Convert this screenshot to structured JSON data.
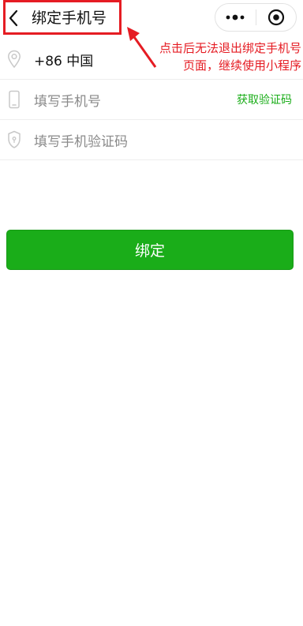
{
  "navbar": {
    "title": "绑定手机号",
    "back_icon": "chevron-left-icon",
    "more_icon": "more-dots-icon",
    "close_icon": "target-circle-icon"
  },
  "annotation": {
    "text": "点击后无法退出绑定手机号页面，继续使用小程序",
    "color": "#e51c23"
  },
  "form": {
    "region": {
      "icon": "location-pin-icon",
      "value": "+86 中国"
    },
    "phone": {
      "icon": "mobile-phone-icon",
      "placeholder": "填写手机号",
      "get_code_label": "获取验证码"
    },
    "code": {
      "icon": "shield-icon",
      "placeholder": "填写手机验证码"
    }
  },
  "bind_button": {
    "label": "绑定",
    "color": "#1aad19"
  }
}
